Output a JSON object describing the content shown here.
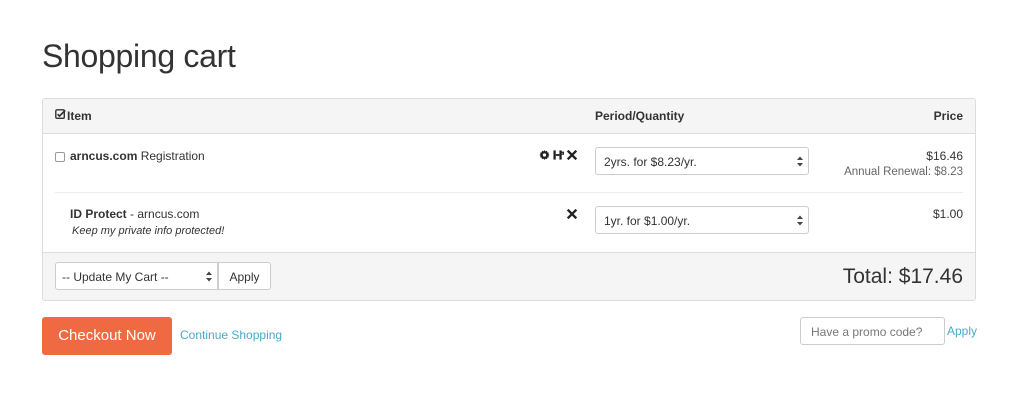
{
  "page": {
    "title": "Shopping cart"
  },
  "table": {
    "headers": {
      "item": "Item",
      "period": "Period/Quantity",
      "price": "Price"
    }
  },
  "items": [
    {
      "domain": "arncus.com",
      "type": " Registration",
      "period": "2yrs. for $8.23/yr.",
      "price": "$16.46",
      "renewal": "Annual Renewal: $8.23",
      "icons": [
        "gear-icon",
        "dns-icon",
        "remove-icon"
      ]
    },
    {
      "name": "ID Protect",
      "suffix": " - arncus.com",
      "description": "Keep my private info protected!",
      "period": "1yr. for $1.00/yr.",
      "price": "$1.00",
      "icons": [
        "remove-icon"
      ]
    }
  ],
  "footer": {
    "update_select": "-- Update My Cart --",
    "apply_label": "Apply",
    "total": "Total: $17.46"
  },
  "actions": {
    "checkout_label": "Checkout Now",
    "continue_label": "Continue Shopping",
    "promo_placeholder": "Have a promo code?",
    "promo_apply_label": "Apply"
  },
  "colors": {
    "checkout": "#ef6a42",
    "link": "#4aa9c9",
    "header_bg": "#f5f5f5"
  }
}
